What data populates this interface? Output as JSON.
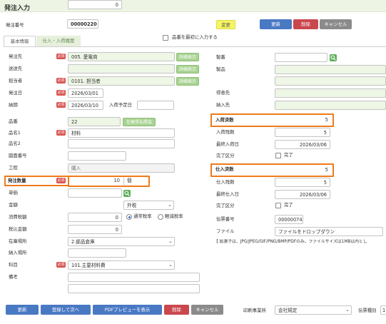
{
  "header": {
    "title": "発注入力"
  },
  "top": {
    "order_no_label": "発注番号",
    "order_no_value": "00000220",
    "change_button": "変更",
    "update_button": "更新",
    "delete_button": "削除",
    "cancel_button": "キャンセル",
    "tab_basic": "基本情報",
    "tab_io": "仕入・入荷履歴",
    "first_check_label": "品番を最初に入力する"
  },
  "required_badge": "必須",
  "detail_label": "詳細表示",
  "left": {
    "supplier_label": "発注先",
    "supplier_value": "005. 愛電商",
    "dest_label": "送送先",
    "staff_label": "担当者",
    "staff_value": "0101. 担当者",
    "order_date_label": "発注日",
    "order_date_value": "2026/03/01",
    "due_label": "納期",
    "due_value": "2026/03/10",
    "arrival_plan_label": "入荷予定日",
    "part_no_label": "品番",
    "part_no_value": "22",
    "stock_button": "在庫受払照会",
    "name1_label": "品名1",
    "name1_value": "材料",
    "name2_label": "品名2",
    "drawing_label": "図面番号",
    "process_label": "工程",
    "process_value": "購入",
    "qty_label": "発注数量",
    "qty_value": "10",
    "qty_unit": "個",
    "unit_price_label": "単価",
    "amount_label": "金額",
    "amount_value": "0",
    "tax_mode": "外税",
    "tax_label": "消費税額",
    "tax_value": "0",
    "radio_normal": "通常税率",
    "radio_reduced": "軽減税率",
    "with_tax_label": "税込金額",
    "with_tax_value": "0",
    "stock_place_label": "在庫場所",
    "stock_place_value": "2.部品倉庫",
    "delivery_place_label": "納入場所",
    "account_label": "科目",
    "account_value": "101.主要材料費",
    "remarks_label": "備考"
  },
  "right": {
    "seiban_label": "製番",
    "product_label": "製品",
    "customer_label": "得意先",
    "delivery_label": "納入先",
    "recv_count_label": "入荷済数",
    "recv_count_value": "5",
    "recv_remain_label": "入荷残数",
    "recv_remain_value": "5",
    "last_recv_label": "最終入荷日",
    "last_recv_value": "2026/03/06",
    "complete_label": "完了区分",
    "complete_text": "完了",
    "purch_count_label": "仕入済数",
    "purch_count_value": "5",
    "purch_remain_label": "仕入残数",
    "purch_remain_value": "5",
    "last_purch_label": "最終仕入日",
    "last_purch_value": "2026/03/06",
    "complete2_label": "完了区分",
    "complete2_text": "完了",
    "voucher_label": "伝票番号",
    "voucher_value": "00000074",
    "file_label": "ファイル",
    "file_value": "ファイルをドロップダウン",
    "note": "【 拡張子は、JPG/JPEG/GIF/PNG/BMP/PDFのみ。ファイルサイズは1MB以内とし"
  },
  "bottom": {
    "update": "更新",
    "register_next": "登録して次へ",
    "pdf_preview": "PDFプレビューを表示",
    "delete": "削除",
    "cancel": "キャンセル",
    "print_office_label": "印刷事業所",
    "print_office_value": "会社規定",
    "voucher_type_label": "伝票種別",
    "voucher_type_value": "1"
  },
  "colors": {
    "highlight": "#ef7a1a",
    "required": "#d9534f",
    "blue": "#4a79c4",
    "red": "#c9484e",
    "gray": "#8b8b8b",
    "green_field": "#eef6e6"
  }
}
